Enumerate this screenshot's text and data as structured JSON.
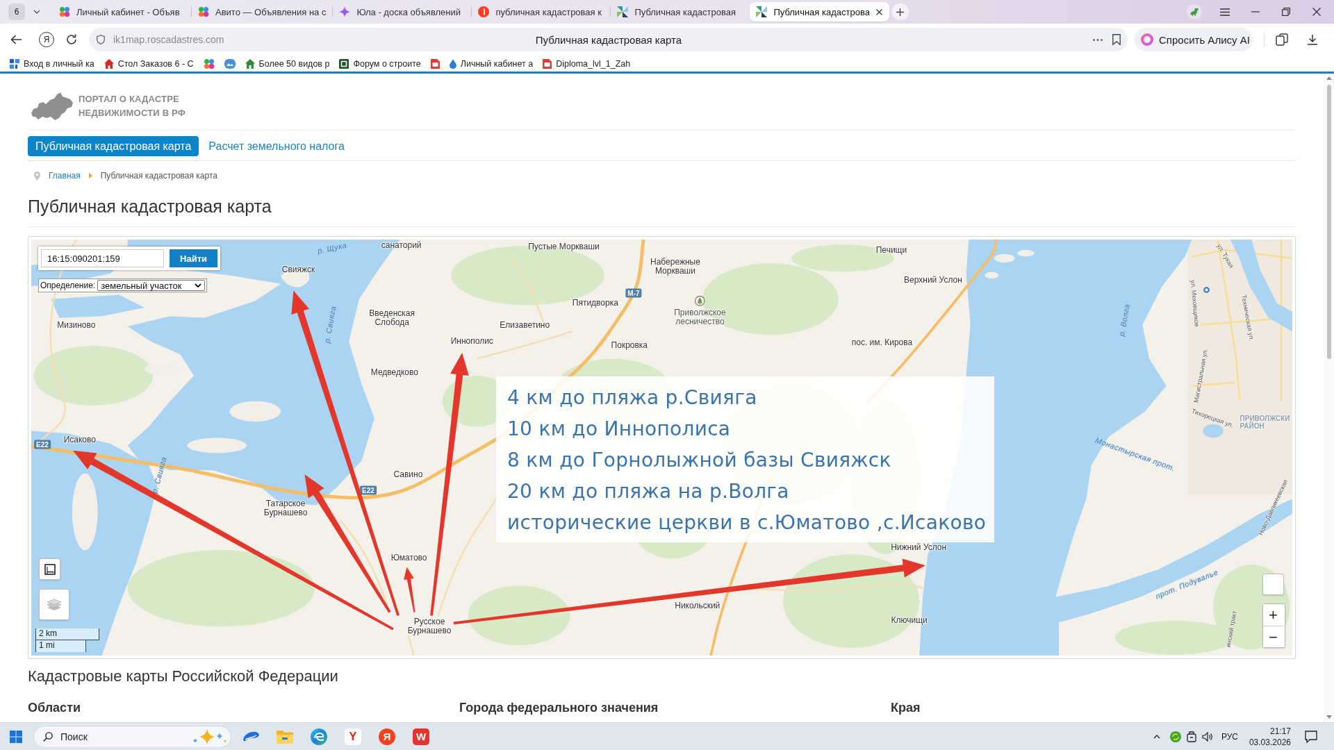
{
  "browser": {
    "tab_count": "6",
    "tabs": [
      {
        "kind": "dots",
        "title": "Личный кабинет - Объяв",
        "selected": false
      },
      {
        "kind": "dots",
        "title": "Авито — Объявления на с",
        "selected": false
      },
      {
        "kind": "star",
        "title": "Юла - доска объявлений",
        "selected": false
      },
      {
        "kind": "disc",
        "title": "публичная кадастровая к",
        "selected": false
      },
      {
        "kind": "pinwheel",
        "title": "Публичная кадастровая",
        "selected": false
      },
      {
        "kind": "pinwheel",
        "title": "Публичная кадастрова",
        "selected": true
      }
    ],
    "home_glyph": "Я",
    "address": {
      "url": "ik1map.roscadastres.com",
      "page_title": "Публичная кадастровая карта"
    },
    "assistant_button": "Спросить Алису AI",
    "bookmarks": [
      {
        "kind": "grid",
        "label": "Вход в личный ка"
      },
      {
        "kind": "house",
        "label": "Стол Заказов 6 - С"
      },
      {
        "kind": "dots"
      },
      {
        "kind": "image"
      },
      {
        "kind": "cottage",
        "label": "Более 50 видов р"
      },
      {
        "kind": "forum",
        "label": "Форум о строите"
      },
      {
        "kind": "pdf"
      },
      {
        "kind": "drop",
        "label": "Личный кабинет а"
      },
      {
        "kind": "pdf",
        "label": "Diploma_lvl_1_Zah"
      }
    ]
  },
  "page": {
    "logo_lines": [
      "ПОРТАЛ О КАДАСТРЕ",
      "НЕДВИЖИМОСТИ В РФ"
    ],
    "nav": [
      {
        "label": "Публичная кадастровая карта",
        "selected": true
      },
      {
        "label": "Расчет земельного налога",
        "selected": false
      }
    ],
    "breadcrumb": [
      {
        "label": "Главная",
        "current": false
      },
      {
        "label": "Публичная кадастровая карта",
        "current": true
      }
    ],
    "heading": "Публичная кадастровая карта",
    "map": {
      "search": {
        "value": "16:15:090201:159",
        "button": "Найти"
      },
      "definition": {
        "label": "Определение:",
        "value": "земельный участок"
      },
      "labels": [
        {
          "kind": "water",
          "lines": [
            "р. Щука"
          ]
        },
        {
          "kind": "place",
          "lines": [
            "санаторий"
          ]
        },
        {
          "kind": "place",
          "lines": [
            "Пустые Моркваши"
          ]
        },
        {
          "kind": "place",
          "lines": [
            "Печищи"
          ]
        },
        {
          "kind": "place",
          "lines": [
            "Свияжск"
          ]
        },
        {
          "kind": "place",
          "lines": [
            "Набережные",
            "Моркваши"
          ]
        },
        {
          "kind": "street",
          "lines": [
            "ул. Тукая"
          ]
        },
        {
          "kind": "place",
          "lines": [
            "Верхний Услон"
          ]
        },
        {
          "kind": "shield",
          "lines": [
            "М-7"
          ]
        },
        {
          "kind": "place",
          "lines": [
            "Пятидворка"
          ]
        },
        {
          "kind": "place",
          "lines": [
            "Мизиново"
          ]
        },
        {
          "kind": "water",
          "lines": [
            "р. Свияга"
          ]
        },
        {
          "kind": "place",
          "lines": [
            "Введенская",
            "Слобода"
          ]
        },
        {
          "kind": "place",
          "lines": [
            "Елизаветино"
          ]
        },
        {
          "kind": "poi",
          "lines": [
            "Приволжское",
            "лесничество"
          ]
        },
        {
          "kind": "water",
          "lines": [
            "р. Волга"
          ]
        },
        {
          "kind": "street",
          "lines": [
            "ул. Меховщиков"
          ]
        },
        {
          "kind": "place",
          "lines": [
            "Иннополис"
          ]
        },
        {
          "kind": "place",
          "lines": [
            "Покровка"
          ]
        },
        {
          "kind": "place",
          "lines": [
            "пос. им. Кирова"
          ]
        },
        {
          "kind": "street",
          "lines": [
            "Техническая ул."
          ]
        },
        {
          "kind": "place",
          "lines": [
            "Медведково"
          ]
        },
        {
          "kind": "street",
          "lines": [
            "Магистральная ул."
          ]
        },
        {
          "kind": "street",
          "lines": [
            "Тихорецкая ул."
          ]
        },
        {
          "kind": "district",
          "lines": [
            "ПРИВОЛЖСКИ",
            "РАЙОН"
          ]
        },
        {
          "kind": "shield",
          "lines": [
            "E22"
          ]
        },
        {
          "kind": "place",
          "lines": [
            "Исаково"
          ]
        },
        {
          "kind": "water",
          "lines": [
            "р. Свияга"
          ]
        },
        {
          "kind": "water",
          "lines": [
            "Монастырская прот."
          ]
        },
        {
          "kind": "place",
          "lines": [
            "Савино"
          ]
        },
        {
          "kind": "shield",
          "lines": [
            "E22"
          ]
        },
        {
          "kind": "place",
          "lines": [
            "Татарское",
            "Бурнашево"
          ]
        },
        {
          "kind": "street",
          "lines": [
            "Ново-Давликеевская"
          ]
        },
        {
          "kind": "place",
          "lines": [
            "Нижний Услон"
          ]
        },
        {
          "kind": "place",
          "lines": [
            "Юматово"
          ]
        },
        {
          "kind": "water",
          "lines": [
            "прот. Подувалье"
          ]
        },
        {
          "kind": "place",
          "lines": [
            "Никольский"
          ]
        },
        {
          "kind": "place",
          "lines": [
            "Русское",
            "Бурнашево"
          ]
        },
        {
          "kind": "place",
          "lines": [
            "Ключищи"
          ]
        },
        {
          "kind": "street",
          "lines": [
            "инский тракт"
          ]
        }
      ],
      "callout": [
        "4 км до пляжа р.Свияга",
        "10 км до Иннополиса",
        "8 км до Горнолыжной базы Свияжск",
        "20 км до пляжа на р.Волга",
        "исторические церкви в с.Юматово ,с.Исаково"
      ],
      "scale": [
        "2 km",
        "1 mi"
      ],
      "zoom": [
        "+",
        "−"
      ]
    },
    "section_heading": "Кадастровые карты Российской Федерации",
    "columns": [
      "Области",
      "Города федерального значения",
      "Края"
    ]
  },
  "taskbar": {
    "search": {
      "placeholder": "Поиск"
    },
    "apps": [
      {
        "kind": "wave"
      },
      {
        "kind": "folder"
      },
      {
        "kind": "swirl"
      },
      {
        "kind": "tile",
        "glyph": "Y"
      },
      {
        "kind": "disc",
        "glyph": "Я"
      },
      {
        "kind": "square",
        "glyph": "W"
      }
    ],
    "language": "РУС",
    "time": "21:17",
    "date": "03.03.2026"
  }
}
